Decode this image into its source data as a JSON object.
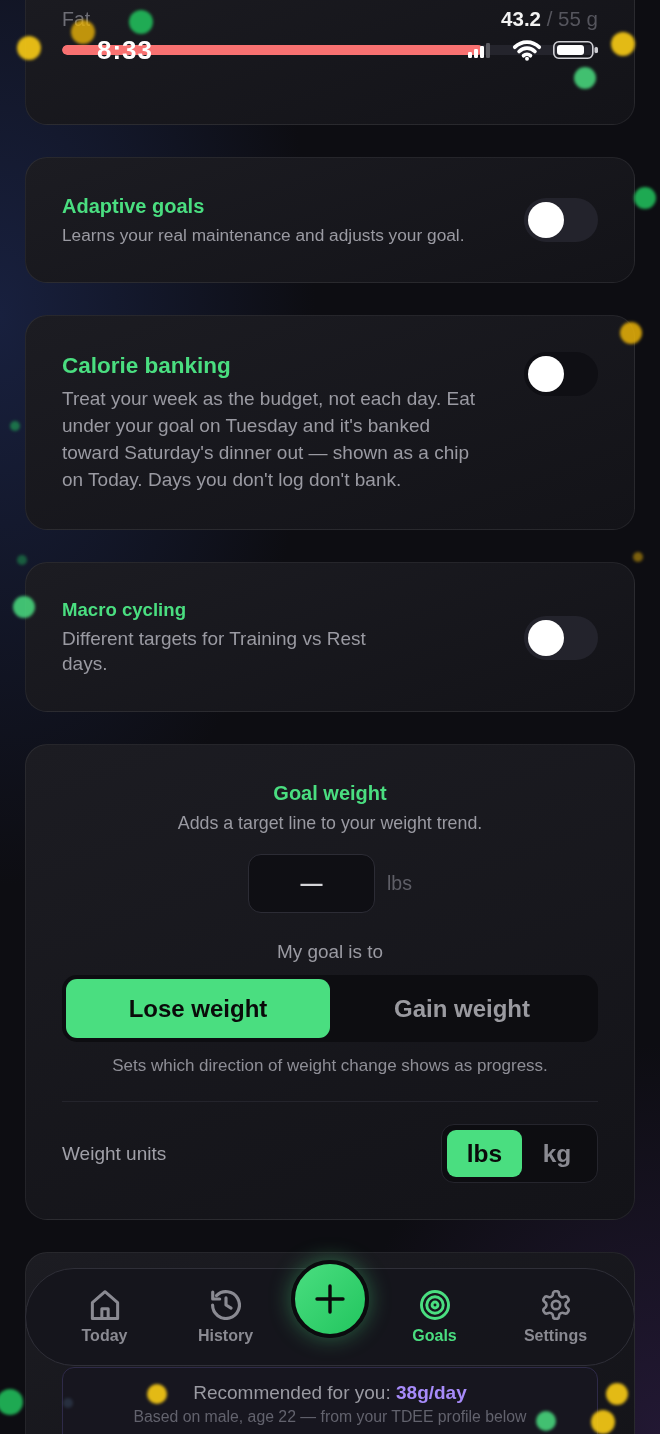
{
  "status_bar": {
    "time": "8:33"
  },
  "macro_card": {
    "label": "Fat",
    "value": "43.2",
    "target": "/ 55 g",
    "level": 0.785
  },
  "settings": [
    {
      "title": "Adaptive goals",
      "description": "Learns your real maintenance and adjusts your goal.",
      "on": false
    },
    {
      "title": "Calorie banking",
      "description": "Treat your week as the budget, not each day. Eat under your goal on Tuesday and it's banked toward Saturday's dinner out — shown as a chip on Today. Days you don't log don't bank.",
      "on": false
    },
    {
      "title": "Macro cycling",
      "description": "Different targets for Training vs Rest days.",
      "on": false
    }
  ],
  "goal_weight": {
    "title": "Goal weight",
    "subtitle": "Adds a target line to your weight trend.",
    "input": {
      "value": "—"
    },
    "unit": "lbs",
    "goal_label": "My goal is to",
    "goal_options": [
      {
        "label": "Lose weight",
        "selected": true
      },
      {
        "label": "Gain weight",
        "selected": false
      }
    ],
    "goal_note": "Sets which direction of weight change shows as progress.",
    "units_label": "Weight units",
    "units": [
      {
        "label": "lbs",
        "selected": true
      },
      {
        "label": "kg",
        "selected": false
      }
    ]
  },
  "recommendation": {
    "label": "Recommended for you:",
    "amount": "38g/day",
    "note": "Based on male, age 22 — from your TDEE profile below"
  },
  "tab_bar": {
    "items": [
      {
        "kind": "tab",
        "label": "Today",
        "selected": false
      },
      {
        "kind": "tab",
        "label": "History",
        "selected": false
      },
      {
        "kind": "action"
      },
      {
        "kind": "tab",
        "label": "Goals",
        "selected": true
      },
      {
        "kind": "tab",
        "label": "Settings",
        "selected": false
      }
    ]
  }
}
